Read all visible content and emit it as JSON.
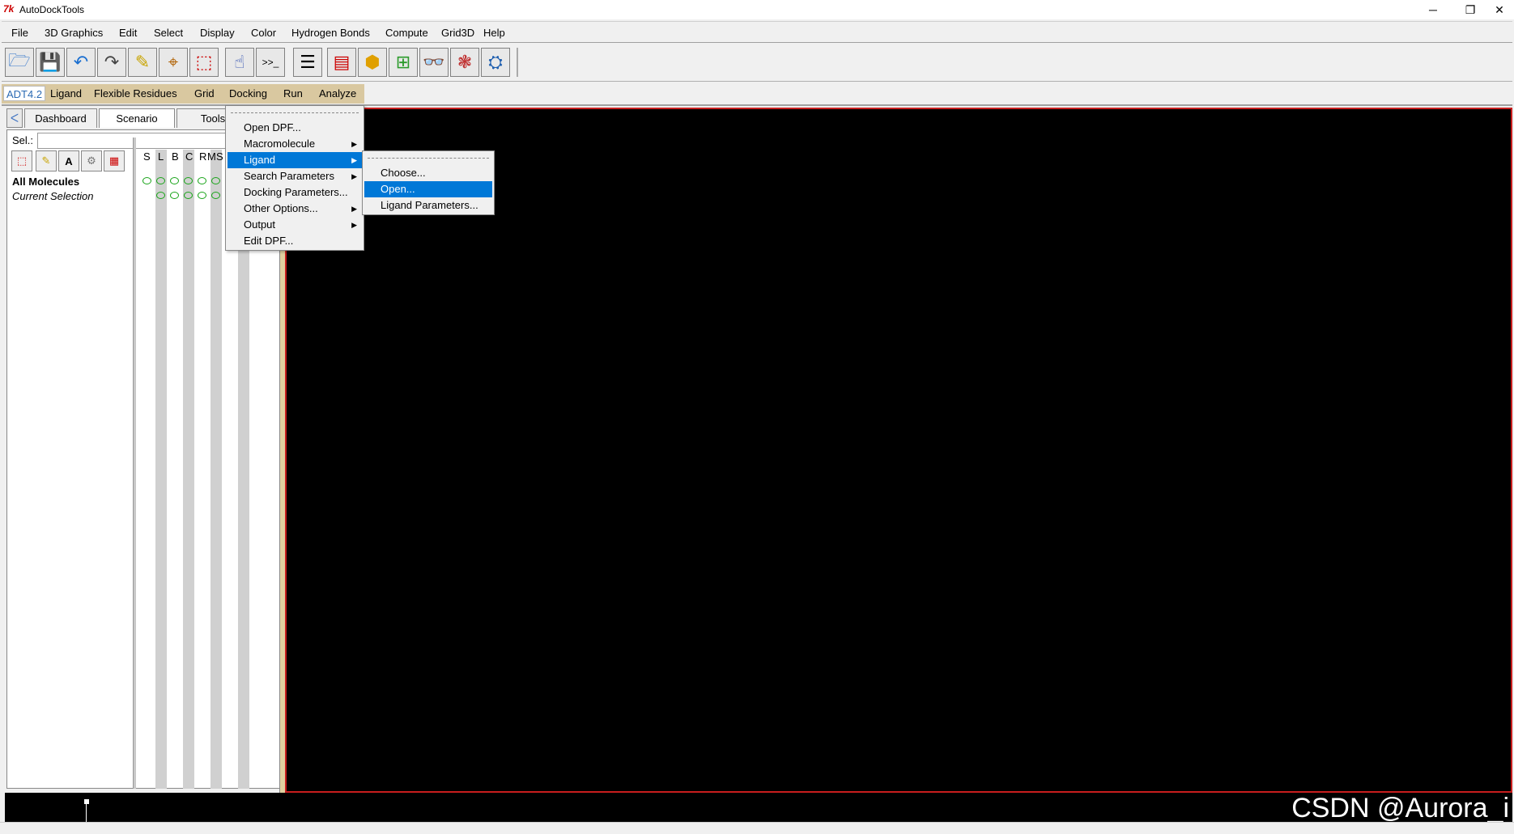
{
  "window": {
    "title": "AutoDockTools",
    "controls": {
      "minimize": "─",
      "maximize": "❐",
      "close": "✕"
    }
  },
  "menubar": [
    "File",
    "3D Graphics",
    "Edit",
    "Select",
    "Display",
    "Color",
    "Hydrogen Bonds",
    "Compute",
    "Grid3D",
    "Help"
  ],
  "toolbar": {
    "icons": [
      "open-folder-icon",
      "save-icon",
      "undo-icon",
      "redo-icon",
      "pencil-icon",
      "crosshair-icon",
      "selection-icon",
      "hand-pointer-icon",
      "python-shell-icon",
      "text-align-icon",
      "monitor-icon",
      "color-sphere-icon",
      "tree-icon",
      "3d-glasses-icon",
      "dna-icon",
      "pmv-logo-icon"
    ]
  },
  "adt_menubar": {
    "items": [
      "ADT4.2",
      "Ligand",
      "Flexible Residues",
      "Grid",
      "Docking",
      "Run",
      "Analyze"
    ],
    "selected": "ADT4.2"
  },
  "left_panel": {
    "tabs": [
      "Dashboard",
      "Scenario",
      "Tools"
    ],
    "selector_label": "Sel.:",
    "selector_value": "",
    "column_headers": [
      "S",
      "L",
      "B",
      "C",
      "R",
      "M",
      "S"
    ],
    "rows": [
      {
        "label": "All Molecules",
        "bold": true
      },
      {
        "label": "Current Selection",
        "italic": true
      }
    ]
  },
  "docking_menu": {
    "items": [
      {
        "label": "Open DPF...",
        "submenu": false
      },
      {
        "label": "Macromolecule",
        "submenu": true
      },
      {
        "label": "Ligand",
        "submenu": true,
        "highlighted": true
      },
      {
        "label": "Search Parameters",
        "submenu": true
      },
      {
        "label": "Docking Parameters...",
        "submenu": false
      },
      {
        "label": "Other Options...",
        "submenu": true
      },
      {
        "label": "Output",
        "submenu": true
      },
      {
        "label": "Edit DPF...",
        "submenu": false
      }
    ]
  },
  "ligand_submenu": {
    "items": [
      {
        "label": "Choose...",
        "highlighted": false
      },
      {
        "label": "Open...",
        "highlighted": true
      },
      {
        "label": "Ligand Parameters...",
        "highlighted": false
      }
    ]
  },
  "watermark": "CSDN @Aurora_i",
  "colors": {
    "viewer_bg": "#000000",
    "viewer_border": "#c81e1e",
    "menu_highlight": "#0078d7",
    "adt_bar": "#d9c8a0",
    "status_circle": "#19a419"
  }
}
